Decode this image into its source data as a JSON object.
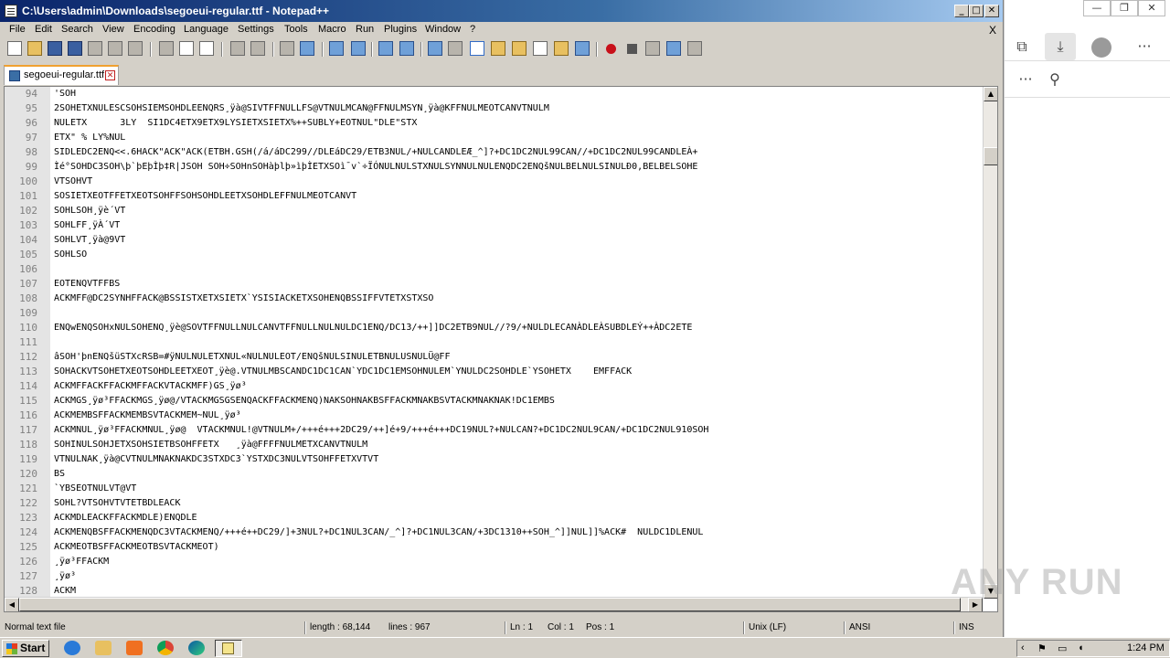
{
  "window": {
    "title": "C:\\Users\\admin\\Downloads\\segoeui-regular.ttf - Notepad++",
    "min_glyph": "_",
    "max_glyph": "□",
    "close_glyph": "✕"
  },
  "menu": {
    "items": [
      "File",
      "Edit",
      "Search",
      "View",
      "Encoding",
      "Language",
      "Settings",
      "Tools",
      "Macro",
      "Run",
      "Plugins",
      "Window",
      "?"
    ],
    "close": "X"
  },
  "tab": {
    "label": "segoeui-regular.ttf",
    "close_glyph": "✕"
  },
  "editor": {
    "lines": [
      {
        "n": "94",
        "t": "'SOH"
      },
      {
        "n": "95",
        "t": "2SOHETXNULESCSOHSIEMSOHDLEENQRS¸ÿà@SIVTFFNULLFS@VTNULMCAN@FFNULMSYN¸ÿà@KFFNULMEOTCANVTNULM"
      },
      {
        "n": "96",
        "t": "NULETX      3LY  SI1DC4ETX9ETX9LYSIETXSIETX%++SUBLY+EOTNUL\"DLE\"STX"
      },
      {
        "n": "97",
        "t": "ETX\" % LY%NUL"
      },
      {
        "n": "98",
        "t": "SIDLEDC2ENQ<<.6HACK\"ACK\"ACK(ETBH.GSH(/á/áDC299//DLEáDC29/ETB3NUL/+NULCANDLEÆ_^]?+DC1DC2NUL99CAN//+DC1DC2NUL99CANDLEÀ+"
      },
      {
        "n": "99",
        "t": "Ìé°SOHDC3SOH\\þ`þEþÌþ‡R|JSOH SOH÷SOHnSOHàþlþ»ìþÌETXSOì¯v`÷ÏÓNULNULSTXNULSYNNULNULENQDC2ENQšNULBELNULSINULÐ0,BELBELSOHE"
      },
      {
        "n": "100",
        "t": "VTSOHVT"
      },
      {
        "n": "101",
        "t": "SOSIETXEOTFFETXEOTSOHFFSOHSOHDLEETXSOHDLEFFNULMEOTCANVT"
      },
      {
        "n": "102",
        "t": "SOHLSOH¸ÿè´VT"
      },
      {
        "n": "103",
        "t": "SOHLFF¸ÿÀ´VT"
      },
      {
        "n": "104",
        "t": "SOHLVT¸ÿà@9VT"
      },
      {
        "n": "105",
        "t": "SOHLSO"
      },
      {
        "n": "106",
        "t": ""
      },
      {
        "n": "107",
        "t": "EOTENQVTFFBS"
      },
      {
        "n": "108",
        "t": "ACKMFF@DC2SYNHFFACK@BSSISTXETXSIETX`YSISIACKETXSOHENQBSSIFFVTETXSTXSO"
      },
      {
        "n": "109",
        "t": ""
      },
      {
        "n": "110",
        "t": "ENQwENQSOHxNULSOHENQ¸ÿè@SOVTFFNULLNULCANVTFFNULLNULNULDC1ENQ/DC13/++]]DC2ETB9NUL//?9/+NULDLECANÀDLEÀSUBDLEÝ++ÀDC2ETE"
      },
      {
        "n": "111",
        "t": ""
      },
      {
        "n": "112",
        "t": "âSOH'þnENQšüSTXcRSB=#ÿNULNULETXNUL«NULNULEOT/ENQšNULSINULETBNULUSNULÜ@FF"
      },
      {
        "n": "113",
        "t": "SOHACKVTSOHETXEOTSOHDLEETXEOT¸ÿè@.VTNULMBSCANDC1DC1CAN`YDC1DC1EMSOHNULEM`YNULDC2SOHDLE`YSOHETX    EMFFACK"
      },
      {
        "n": "114",
        "t": "ACKMFFACKFFACKMFFACKVTACKMFF)GS¸ÿø³"
      },
      {
        "n": "115",
        "t": "ACKMGS¸ÿø³FFACKMGS¸ÿø@/VTACKMGSGSENQACKFFACKMENQ)NAKSOHNAKBSFFACKMNAKBSVTACKMNAKNAK!DC1EMBS"
      },
      {
        "n": "116",
        "t": "ACKMEMBSFFACKMEMBSVTACKMEM~NUL¸ÿø³"
      },
      {
        "n": "117",
        "t": "ACKMNUL¸ÿø³FFACKMNUL¸ÿø@  VTACKMNUL!@VTNULM+/+++é+++2DC29/++]é+9/+++é+++DC19NUL?+NULCAN?+DC1DC2NUL9CAN/+DC1DC2NUL910SOH"
      },
      {
        "n": "118",
        "t": "SOHINULSOHJETXSOHSIETBSOHFFETX   ¸ÿà@FFFFNULMETXCANVTNULM"
      },
      {
        "n": "119",
        "t": "VTNULNAK¸ÿà@CVTNULMNAKNAKDC3STXDC3`YSTXDC3NULVTSOHFFETXVTVT"
      },
      {
        "n": "120",
        "t": "BS"
      },
      {
        "n": "121",
        "t": "`YBSEOTNULVT@VT"
      },
      {
        "n": "122",
        "t": "SOHL?VTSOHVTVTETBDLEACK"
      },
      {
        "n": "123",
        "t": "ACKMDLEACKFFACKMDLE)ENQDLE"
      },
      {
        "n": "124",
        "t": "ACKMENQBSFFACKMENQDC3VTACKMENQ/+++é++DC29/]+3NUL?+DC1NUL3CAN/_^]?+DC1NUL3CAN/+3DC1310++SOH_^]]NUL]]%ACK#  NULDC1DLENUL"
      },
      {
        "n": "125",
        "t": "ACKMEOTBSFFACKMEOTBSVTACKMEOT)"
      },
      {
        "n": "126",
        "t": "¸ÿø³FFACKM"
      },
      {
        "n": "127",
        "t": "¸ÿø³"
      },
      {
        "n": "128",
        "t": "ACKM"
      }
    ]
  },
  "status": {
    "type": "Normal text file",
    "length": "length : 68,144",
    "lines": "lines : 967",
    "ln": "Ln : 1",
    "col": "Col : 1",
    "pos": "Pos : 1",
    "eol": "Unix (LF)",
    "encoding": "ANSI",
    "mode": "INS"
  },
  "edge_panel": {
    "min_glyph": "—",
    "restore_glyph": "❐",
    "close_glyph": "✕",
    "more_glyph": "···"
  },
  "watermark": "ANY RUN",
  "taskbar": {
    "start_label": "Start",
    "clock": "1:24 PM"
  },
  "colors": {
    "titlebar": "#0a246a",
    "control_token_bg": "#000000",
    "control_token_fg": "#ffffff",
    "tab_accent": "#f0a030"
  }
}
